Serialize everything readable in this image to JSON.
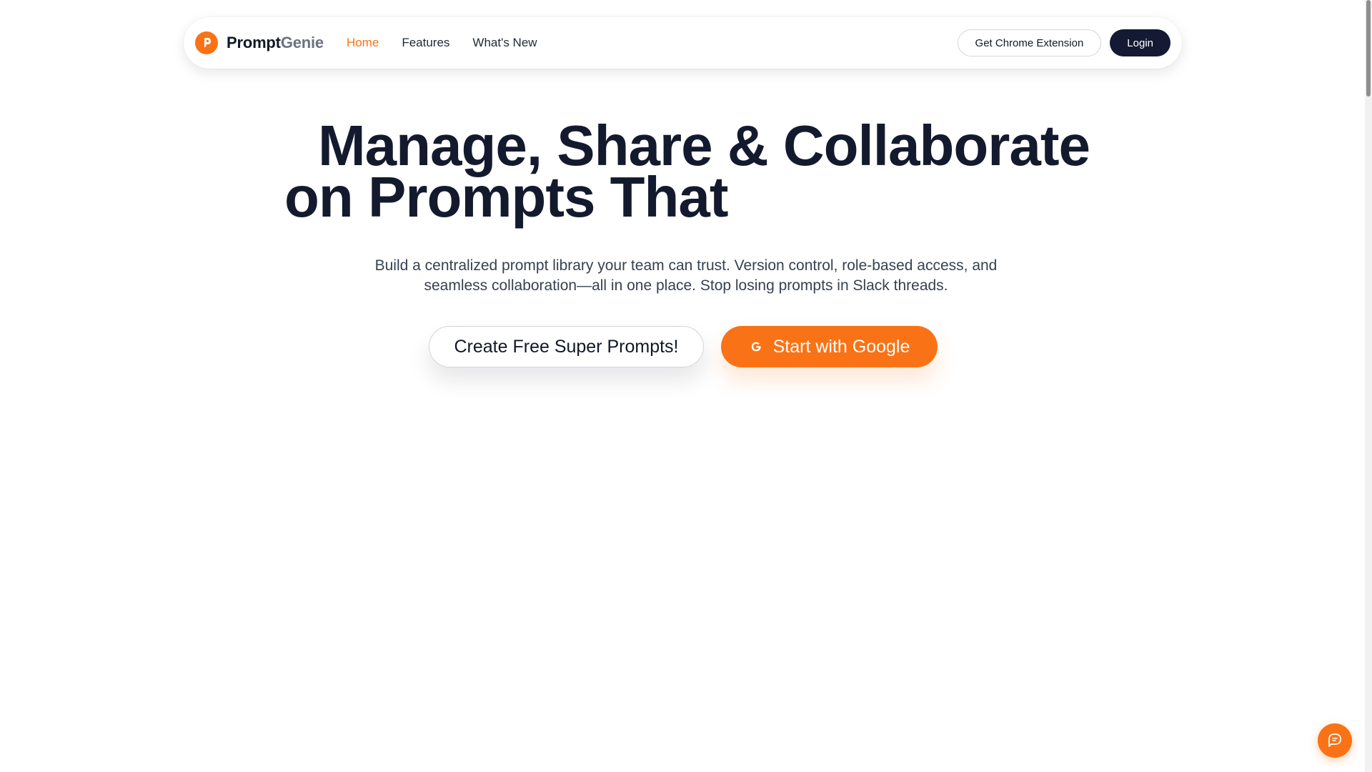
{
  "nav": {
    "brand_part1": "Prompt",
    "brand_part2": "Genie",
    "links": [
      {
        "label": "Home",
        "active": true
      },
      {
        "label": "Features",
        "active": false
      },
      {
        "label": "What's New",
        "active": false
      }
    ],
    "chrome_extension_label": "Get Chrome Extension",
    "login_label": "Login"
  },
  "hero": {
    "title_line1": "Manage, Share & Collaborate",
    "title_line2": "on Prompts That",
    "subtitle_line1": "Build a centralized prompt library your team can trust. Version control, role-based access, and",
    "subtitle_line2": "seamless collaboration—all in one place. Stop losing prompts in Slack threads.",
    "cta_primary_label": "Create Free Super Prompts!",
    "cta_google_label": "Start with Google"
  },
  "icons": {
    "logo": "promptgenie-logo-icon",
    "google": "google-g-icon",
    "chat": "chat-bubble-icon"
  },
  "colors": {
    "accent": "#f97316",
    "dark": "#141a33",
    "text": "#111827"
  }
}
